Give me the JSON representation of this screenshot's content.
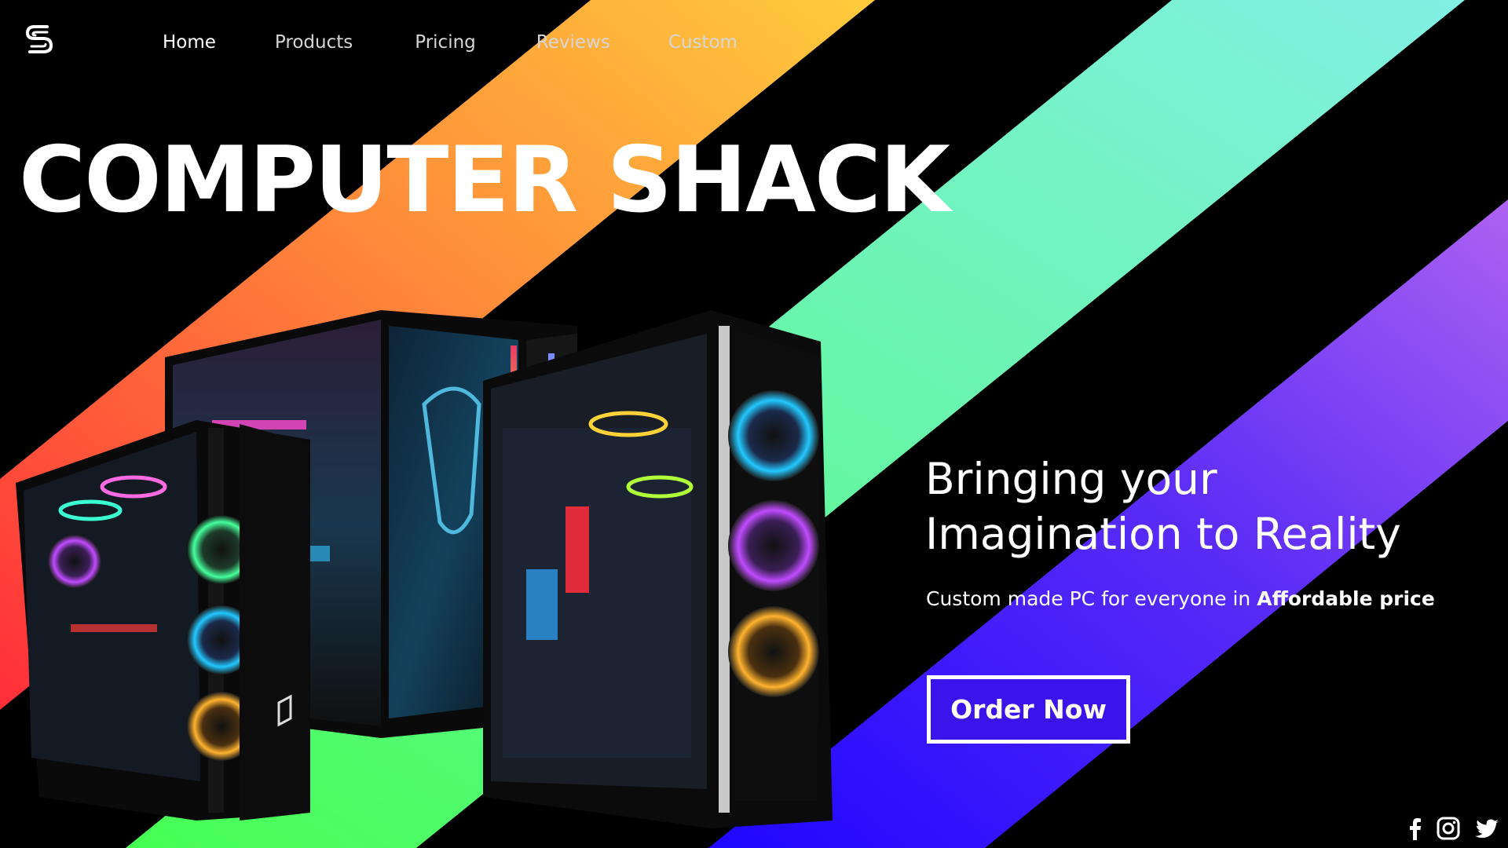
{
  "brand": {
    "logo_icon": "s-logo-icon"
  },
  "nav": {
    "items": [
      {
        "label": "Home",
        "active": true
      },
      {
        "label": "Products",
        "active": false
      },
      {
        "label": "Pricing",
        "active": false
      },
      {
        "label": "Reviews",
        "active": false
      },
      {
        "label": "Custom",
        "active": false
      }
    ]
  },
  "hero": {
    "title": "COMPUTER SHACK",
    "tagline_line1": "Bringing your",
    "tagline_line2": "Imagination to Reality",
    "subtext_prefix": "Custom made PC for everyone in ",
    "subtext_bold": "Affordable price",
    "cta_label": "Order Now",
    "image_icon": "gaming-pc-cases-image"
  },
  "social": {
    "icons": [
      "facebook-icon",
      "instagram-icon",
      "twitter-icon"
    ]
  },
  "colors": {
    "background": "#000000",
    "stripe_orange_start": "#ff3a3a",
    "stripe_orange_end": "#ffc93a",
    "stripe_green_start": "#4dff5a",
    "stripe_green_end": "#7ef5df",
    "stripe_purple_start": "#2a0cff",
    "stripe_purple_end": "#a758f5",
    "cta_background": "#3a14ea"
  }
}
